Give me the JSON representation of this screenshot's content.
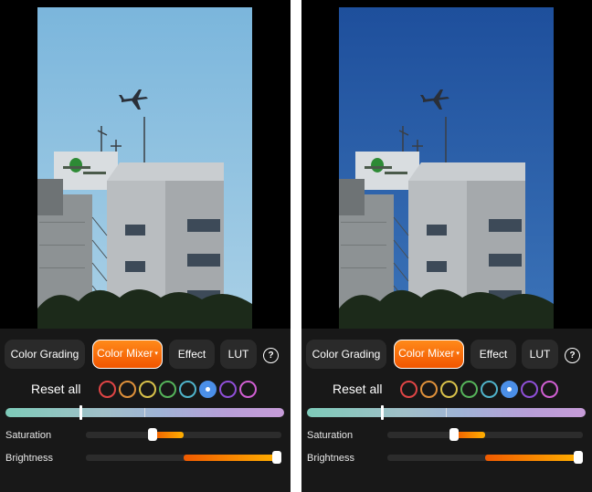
{
  "screens": [
    {
      "id": "before",
      "tabs": [
        {
          "label": "Color Grading"
        },
        {
          "label": "Color Mixer",
          "active": true,
          "caret": "▾"
        },
        {
          "label": "Effect"
        },
        {
          "label": "LUT"
        }
      ],
      "help_glyph": "?",
      "reset_label": "Reset all",
      "swatches": [
        {
          "color": "#e04545"
        },
        {
          "color": "#e0913a"
        },
        {
          "color": "#d9c24a"
        },
        {
          "color": "#55b45a"
        },
        {
          "color": "#4fb4cc"
        },
        {
          "color": "#4b8fe8",
          "selected": true
        },
        {
          "color": "#8f4fd8"
        },
        {
          "color": "#d15fd3"
        }
      ],
      "hue_position": 0.27,
      "sliders": [
        {
          "label": "Saturation",
          "value": -0.32
        },
        {
          "label": "Brightness",
          "value": 0.97
        }
      ],
      "photo": {
        "sky_top": "#7bb6dc",
        "sky_bottom": "#a9d0e6"
      }
    },
    {
      "id": "after",
      "tabs": [
        {
          "label": "Color Grading"
        },
        {
          "label": "Color Mixer",
          "active": true,
          "caret": "▾"
        },
        {
          "label": "Effect"
        },
        {
          "label": "LUT"
        }
      ],
      "help_glyph": "?",
      "reset_label": "Reset all",
      "swatches": [
        {
          "color": "#e04545"
        },
        {
          "color": "#e0913a"
        },
        {
          "color": "#d9c24a"
        },
        {
          "color": "#55b45a"
        },
        {
          "color": "#4fb4cc"
        },
        {
          "color": "#4b8fe8",
          "selected": true
        },
        {
          "color": "#8f4fd8"
        },
        {
          "color": "#d15fd3"
        }
      ],
      "hue_position": 0.27,
      "sliders": [
        {
          "label": "Saturation",
          "value": -0.32
        },
        {
          "label": "Brightness",
          "value": 0.97
        }
      ],
      "photo": {
        "sky_top": "#1e4f9c",
        "sky_bottom": "#3b73b8"
      }
    }
  ],
  "icons": {
    "help": "question-circle-icon",
    "caret": "chevron-down-icon"
  }
}
